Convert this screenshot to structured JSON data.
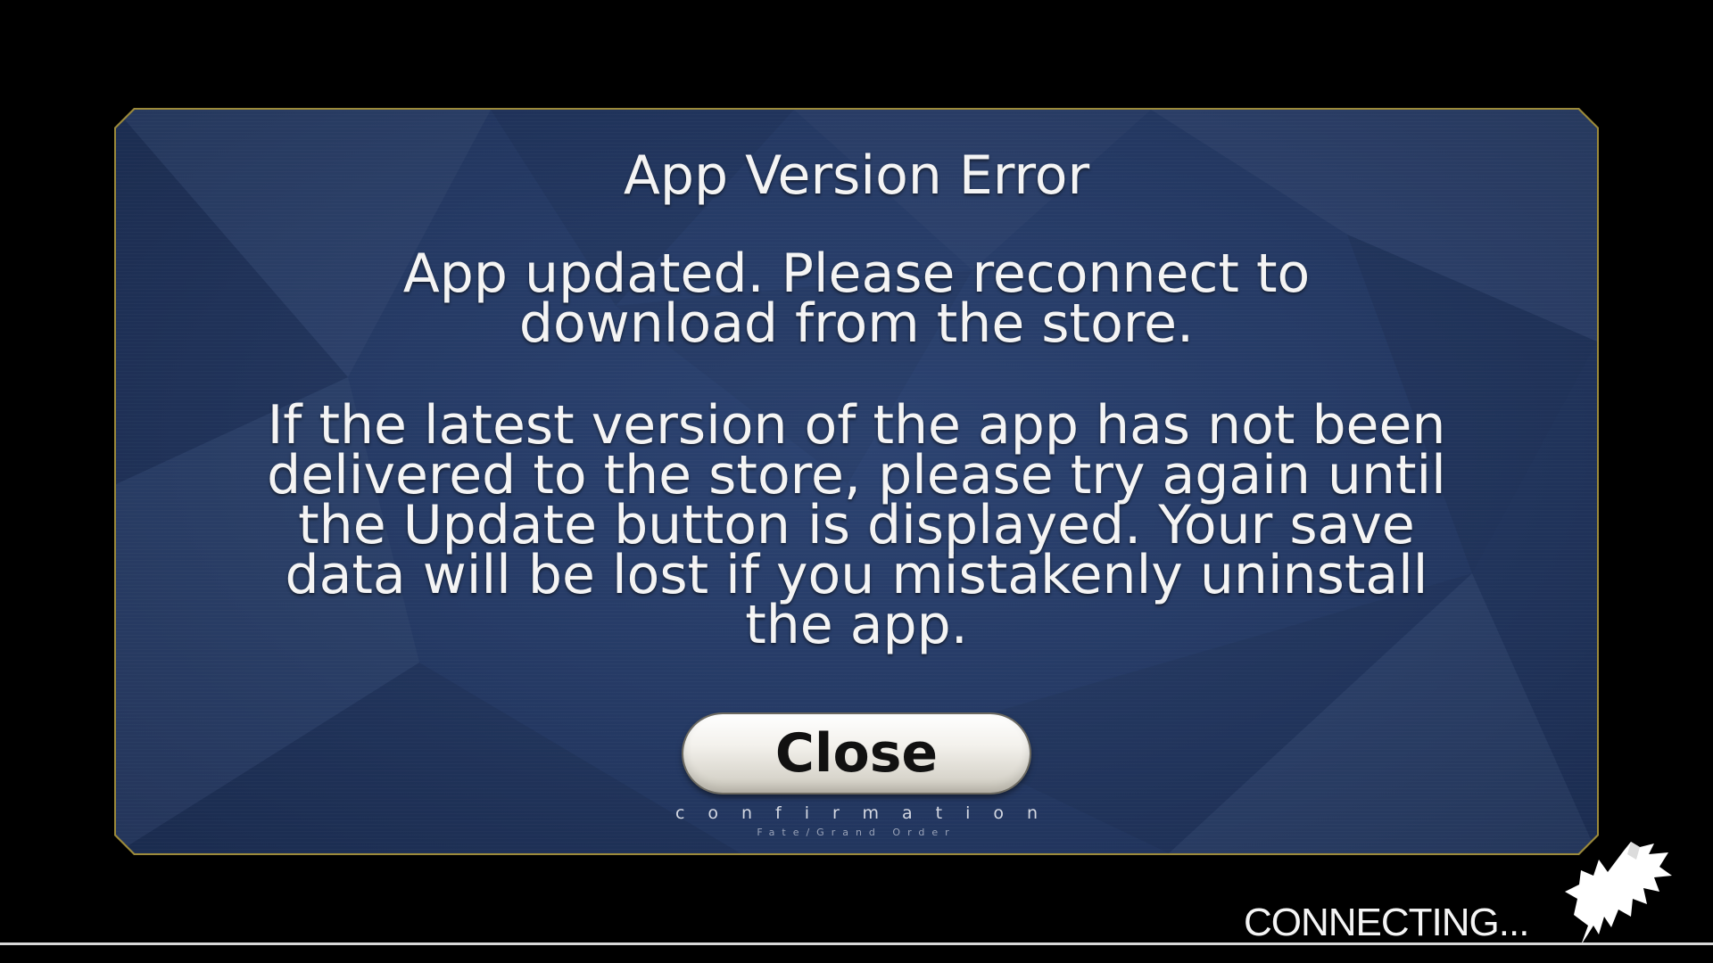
{
  "dialog": {
    "title": "App Version Error",
    "message_1": "App updated. Please reconnect to download from the store.",
    "message_2": "If the latest version of the app has not been delivered to the store, please try again until the Update button is displayed. Your save data will be lost if you mistakenly uninstall the app.",
    "close_label": "Close",
    "confirmation": "confirmation",
    "brand": "Fate/Grand Order"
  },
  "status": {
    "connecting": "CONNECTING..."
  },
  "icons": {
    "mascot": "fou-mascot-icon"
  },
  "colors": {
    "background": "#000000",
    "panel": "#263b66",
    "panel_border": "#9c8a3a",
    "text": "#f4f4f4"
  }
}
